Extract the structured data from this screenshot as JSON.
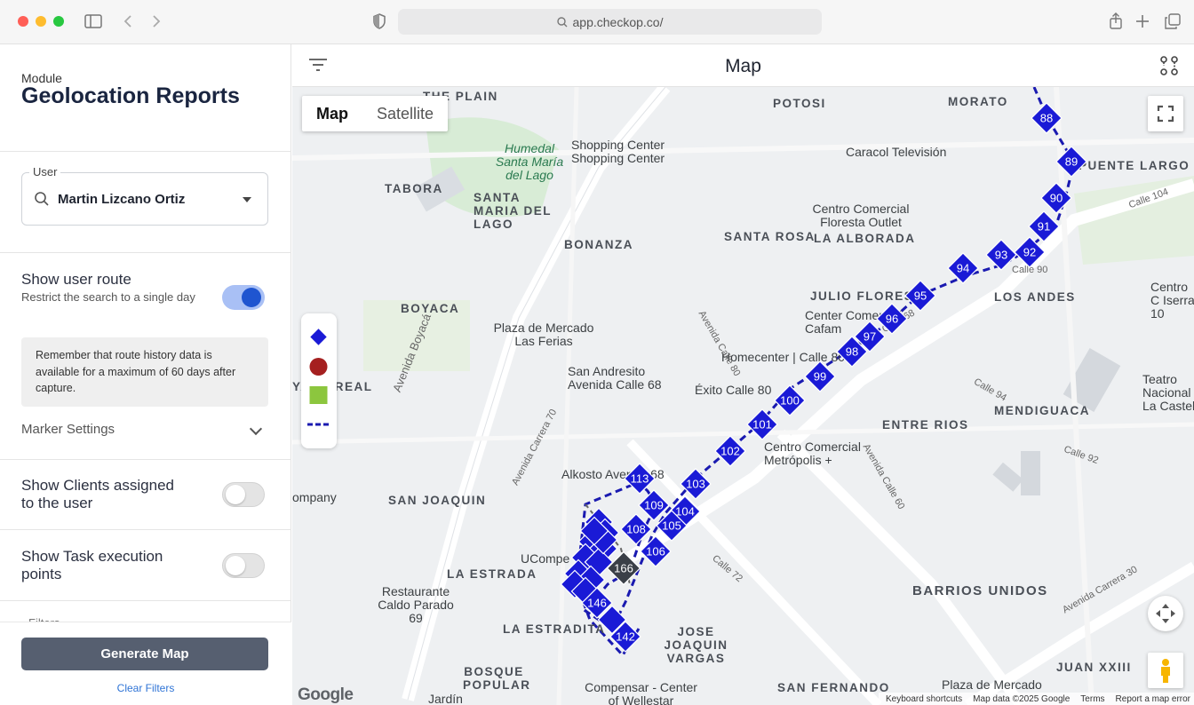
{
  "browser": {
    "url": "app.checkop.co/"
  },
  "sidebar": {
    "module_label": "Module",
    "module_title": "Geolocation Reports",
    "user_field": {
      "label": "User",
      "value": "Martin Lizcano Ortiz"
    },
    "show_route": {
      "title": "Show user route",
      "subtitle": "Restrict the search to a single day",
      "enabled": true
    },
    "info_text": "Remember that route history data is available for a maximum of 60 days after capture.",
    "marker_settings": "Marker Settings",
    "show_clients": {
      "title": "Show Clients assigned to the user",
      "enabled": false
    },
    "show_tasks": {
      "title": "Show Task execution points",
      "enabled": false
    },
    "filters_peek": "Filters",
    "generate_button": "Generate Map",
    "clear_filters": "Clear Filters"
  },
  "header": {
    "title": "Map"
  },
  "map": {
    "type_buttons": [
      "Map",
      "Satellite"
    ],
    "active_type": "Map",
    "legend_colors": {
      "route_marker": "#1a1ad6",
      "client_marker": "#a52020",
      "task_marker": "#8cc63e",
      "route_line": "#1a1ab0"
    },
    "areas": [
      "THE PLAIN",
      "POTOSI",
      "MORATO",
      "TABORA",
      "SANTA MARIA DEL LAGO",
      "BONANZA",
      "SANTA ROSA",
      "LA ALBORADA",
      "PUENTE LARGO",
      "BOYACA",
      "JULIO FLORES",
      "LOS ANDES",
      "YACA REAL",
      "ENTRE RIOS",
      "MENDIGUACA",
      "SAN JOAQUIN",
      "LA ESTRADA",
      "BARRIOS UNIDOS",
      "LA ESTRADITA",
      "JOSE JOAQUIN VARGAS",
      "BOSQUE POPULAR",
      "SAN FERNANDO",
      "JUAN XXIII"
    ],
    "pois": [
      "Humedal Santa María del Lago",
      "Shopping Center Shopping Center",
      "Caracol Televisión",
      "Centro Comercial Floresta Outlet",
      "Plaza de Mercado Las Ferias",
      "Homecenter | Calle 80",
      "Center Comercial Cafam",
      "San Andresito Avenida Calle 68",
      "Éxito Calle 80",
      "Centro Comercial Metrópolis +",
      "Alkosto Avenue 68",
      "UCompe",
      "Restaurante Caldo Parado 69",
      "Compensar - Center of Wellestar",
      "Plaza de Mercado",
      "Teatro Nacional La Castel",
      "Centro C Iserra 10",
      "ompany",
      "Jardín"
    ],
    "streets": [
      "Avenida Boyacá",
      "Avenida Calle 80",
      "Avenida Carrera 70",
      "Avenida Calle 68",
      "Avenida Carrera 30",
      "Calle 90",
      "Avenida Calle 60",
      "Calle 72",
      "Calle 104",
      "Calle 94",
      "Calle 92"
    ],
    "route_markers": [
      88,
      89,
      90,
      91,
      92,
      93,
      94,
      95,
      96,
      97,
      98,
      99,
      100,
      101,
      102,
      103,
      104,
      105,
      106,
      108,
      109,
      113,
      142,
      146
    ],
    "current_marker": 166,
    "footer": [
      "Keyboard shortcuts",
      "Map data ©2025 Google",
      "Terms",
      "Report a map error"
    ],
    "google_logo": "Google"
  }
}
